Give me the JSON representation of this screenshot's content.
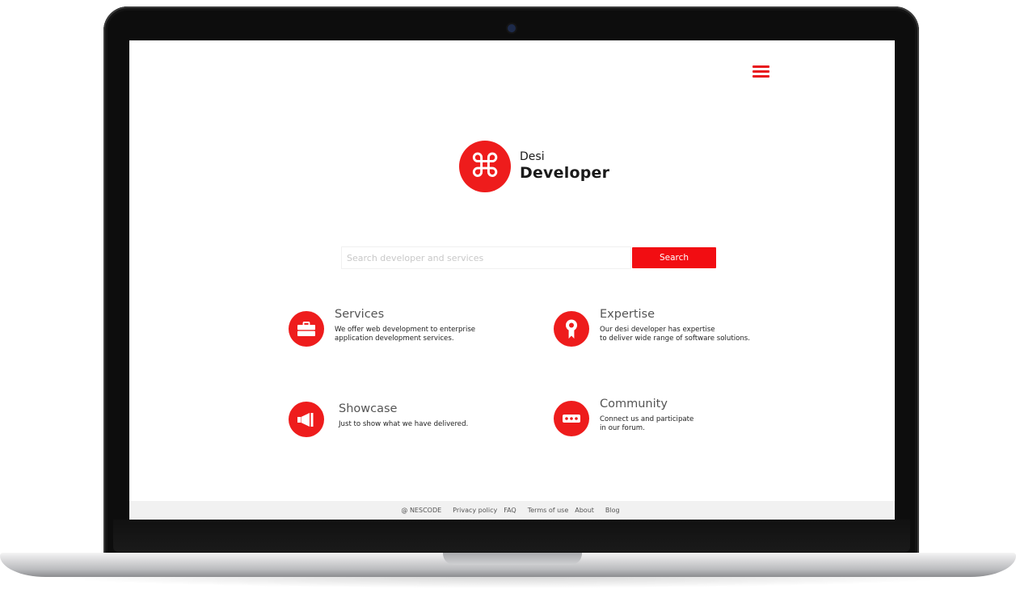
{
  "brand": {
    "name_top": "Desi",
    "name_bottom": "Developer",
    "logo_glyph": "⌘",
    "logo_icon": "command-icon",
    "accent_color": "#ee1c1c"
  },
  "header": {
    "menu_icon": "hamburger-menu-icon"
  },
  "search": {
    "placeholder": "Search developer and services",
    "value": "",
    "button_label": "Search"
  },
  "features": [
    {
      "title": "Services",
      "description": "We offer web development to enterprise\napplication development services.",
      "icon": "briefcase-icon"
    },
    {
      "title": "Expertise",
      "description": "Our desi developer has expertise\nto deliver wide range of software solutions.",
      "icon": "award-icon"
    },
    {
      "title": "Showcase",
      "description": "Just to show what we have delivered.",
      "icon": "megaphone-icon"
    },
    {
      "title": "Community",
      "description": "Connect us and participate\nin our forum.",
      "icon": "chat-bubble-icon"
    }
  ],
  "footer": {
    "copyright": "@ NESCODE",
    "links": [
      "Privacy policy",
      "FAQ",
      "Terms of use",
      "About",
      "Blog"
    ]
  }
}
